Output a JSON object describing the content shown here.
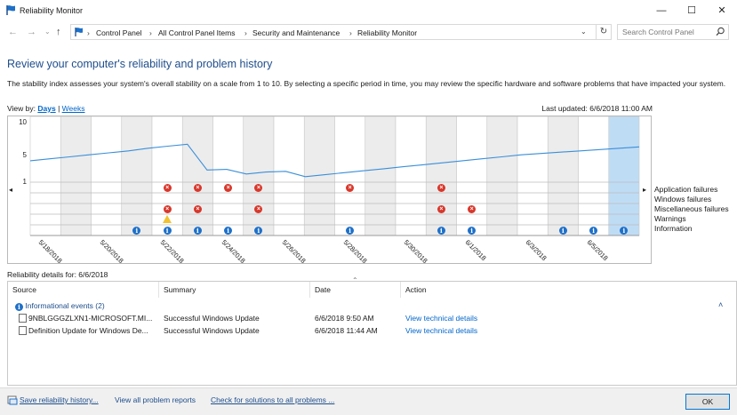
{
  "window": {
    "title": "Reliability Monitor",
    "minimize": "—",
    "maximize": "☐",
    "close": "✕"
  },
  "address": {
    "crumbs": [
      "Control Panel",
      "All Control Panel Items",
      "Security and Maintenance",
      "Reliability Monitor"
    ],
    "search_placeholder": "Search Control Panel"
  },
  "heading": "Review your computer's reliability and problem history",
  "description": "The stability index assesses your system's overall stability on a scale from 1 to 10. By selecting a specific period in time, you may review the specific hardware and software problems that have impacted your system.",
  "view_by": {
    "label": "View by:",
    "days": "Days",
    "sep": "|",
    "weeks": "Weeks"
  },
  "last_updated": "Last updated: 6/6/2018 11:00 AM",
  "chart_data": {
    "type": "line",
    "title": "",
    "ylabel": "",
    "y_ticks": [
      "10",
      "5",
      "1"
    ],
    "ylim": [
      1,
      10
    ],
    "selected_date": "6/6/2018",
    "date_labels": [
      "5/18/2018",
      "5/20/2018",
      "5/22/2018",
      "5/24/2018",
      "5/26/2018",
      "5/28/2018",
      "5/30/2018",
      "6/1/2018",
      "6/3/2018",
      "6/5/2018"
    ],
    "stability_index": [
      4.1,
      4.4,
      4.7,
      5.0,
      5.3,
      5.6,
      6.0,
      6.3,
      6.6,
      2.7,
      2.8,
      2.1,
      2.4,
      2.5,
      1.7,
      2.0,
      2.3,
      2.6,
      2.9,
      3.2,
      3.5,
      3.8,
      4.1,
      4.4,
      4.7,
      5.0,
      5.2,
      5.4,
      5.6,
      5.8,
      6.0,
      6.2
    ],
    "legend": [
      "Application failures",
      "Windows failures",
      "Miscellaneous failures",
      "Warnings",
      "Information"
    ],
    "events": {
      "application_failures": [
        4,
        5,
        6,
        7,
        10,
        13
      ],
      "windows_failures": [],
      "miscellaneous_failures": [
        4,
        5,
        7,
        13,
        14
      ],
      "warnings": [
        4
      ],
      "information": [
        3,
        4,
        5,
        6,
        7,
        10,
        13,
        14,
        17,
        18,
        19
      ]
    },
    "grid": true,
    "columns": 20
  },
  "details": {
    "label": "Reliability details for: 6/6/2018",
    "columns": [
      "Source",
      "Summary",
      "Date",
      "Action"
    ],
    "group": "Informational events (2)",
    "rows": [
      {
        "source": "9NBLGGGZLXN1-MICROSOFT.MI...",
        "summary": "Successful Windows Update",
        "date": "6/6/2018 9:50 AM",
        "action": "View  technical details"
      },
      {
        "source": "Definition Update for Windows De...",
        "summary": "Successful Windows Update",
        "date": "6/6/2018 11:44 AM",
        "action": "View  technical details"
      }
    ]
  },
  "footer": {
    "save": "Save reliability history...",
    "view_all": "View all problem reports",
    "check": "Check for solutions to all problems ...",
    "ok": "OK"
  }
}
